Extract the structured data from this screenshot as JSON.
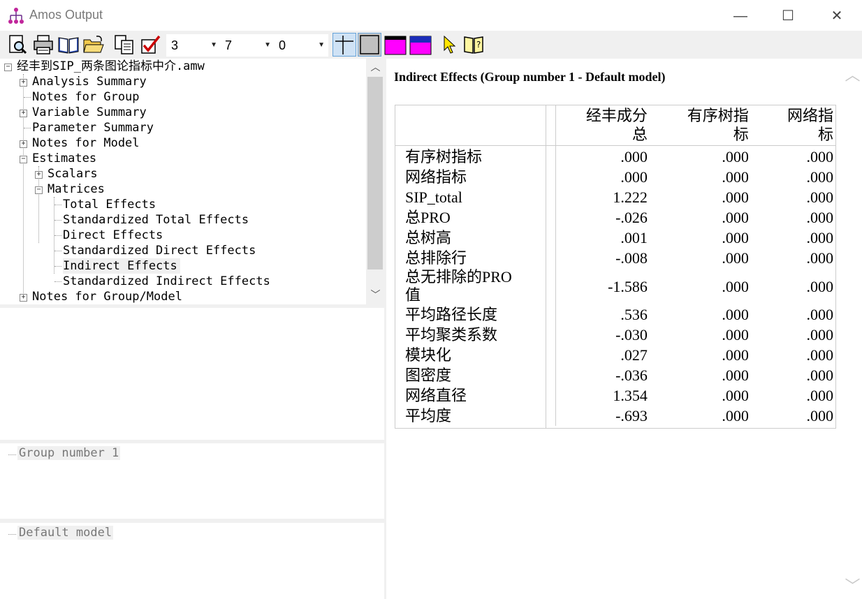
{
  "window": {
    "title": "Amos Output",
    "minimize_glyph": "—",
    "maximize_glyph": "☐",
    "close_glyph": "✕"
  },
  "toolbar": {
    "icons": [
      "print-preview-icon",
      "print-icon",
      "book-icon",
      "open-folder-icon",
      "copy-icon",
      "checkbox-icon"
    ],
    "decimals_value": "3",
    "width_value": "7",
    "minimum_value": "0",
    "combo_arrow": "▼",
    "toggle_icons": [
      "grid-lines-icon",
      "no-grid-icon",
      "magenta-header-icon",
      "blue-header-icon"
    ],
    "extra_icons": [
      "help-pointer-icon",
      "help-book-icon"
    ]
  },
  "tree": {
    "root": "经丰到SIP_两条图论指标中介.amw",
    "items": [
      {
        "label": "Analysis Summary",
        "expander": "+"
      },
      {
        "label": "Notes for Group",
        "expander": ""
      },
      {
        "label": "Variable Summary",
        "expander": "+"
      },
      {
        "label": "Parameter Summary",
        "expander": ""
      },
      {
        "label": "Notes for Model",
        "expander": "+"
      },
      {
        "label": "Estimates",
        "expander": "−"
      },
      {
        "label": "Scalars",
        "expander": "+"
      },
      {
        "label": "Matrices",
        "expander": "−"
      },
      {
        "label": "Total Effects",
        "expander": ""
      },
      {
        "label": "Standardized Total Effects",
        "expander": ""
      },
      {
        "label": "Direct Effects",
        "expander": ""
      },
      {
        "label": "Standardized Direct Effects",
        "expander": ""
      },
      {
        "label": "Indirect Effects",
        "expander": ""
      },
      {
        "label": "Standardized Indirect Effects",
        "expander": ""
      },
      {
        "label": "Notes for Group/Model",
        "expander": "+"
      }
    ],
    "root_expander": "−",
    "scroll_up": "︿",
    "scroll_down": "﹀"
  },
  "groups_pane": {
    "label": "Group number 1"
  },
  "models_pane": {
    "label": "Default model"
  },
  "output": {
    "heading": "Indirect Effects (Group number 1 - Default model)",
    "columns": [
      "经丰成分总",
      "有序树指标",
      "网络指标"
    ],
    "column_lines": [
      [
        "经丰成分",
        "总"
      ],
      [
        "有序树指",
        "标"
      ],
      [
        "网络指",
        "标"
      ]
    ],
    "rows": [
      {
        "label": "有序树指标",
        "values": [
          ".000",
          ".000",
          ".000"
        ]
      },
      {
        "label": "网络指标",
        "values": [
          ".000",
          ".000",
          ".000"
        ]
      },
      {
        "label": "SIP_total",
        "values": [
          "1.222",
          ".000",
          ".000"
        ]
      },
      {
        "label": "总PRO",
        "values": [
          "-.026",
          ".000",
          ".000"
        ]
      },
      {
        "label": "总树高",
        "values": [
          ".001",
          ".000",
          ".000"
        ]
      },
      {
        "label": "总排除行",
        "values": [
          "-.008",
          ".000",
          ".000"
        ]
      },
      {
        "label": "总无排除的PRO值",
        "label_lines": [
          "总无排除的PRO",
          "值"
        ],
        "values": [
          "-1.586",
          ".000",
          ".000"
        ]
      },
      {
        "label": "平均路径长度",
        "values": [
          ".536",
          ".000",
          ".000"
        ]
      },
      {
        "label": "平均聚类系数",
        "values": [
          "-.030",
          ".000",
          ".000"
        ]
      },
      {
        "label": "模块化",
        "values": [
          ".027",
          ".000",
          ".000"
        ]
      },
      {
        "label": "图密度",
        "values": [
          "-.036",
          ".000",
          ".000"
        ]
      },
      {
        "label": "网络直径",
        "values": [
          "1.354",
          ".000",
          ".000"
        ]
      },
      {
        "label": "平均度",
        "values": [
          "-.693",
          ".000",
          ".000"
        ]
      }
    ]
  }
}
